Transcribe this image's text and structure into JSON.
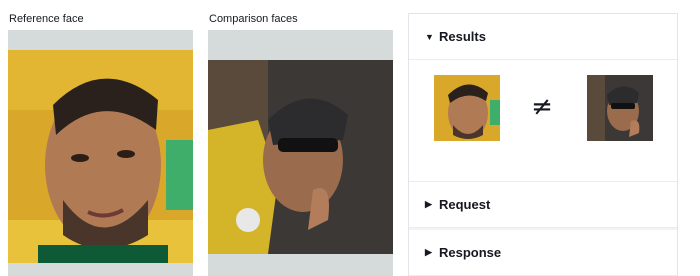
{
  "columns": {
    "reference_label": "Reference face",
    "comparison_label": "Comparison faces"
  },
  "panel": {
    "sections": [
      {
        "label": "Results",
        "state": "expanded",
        "caret": "▼"
      },
      {
        "label": "Request",
        "state": "collapsed",
        "caret": "▶"
      },
      {
        "label": "Response",
        "state": "collapsed",
        "caret": "▶"
      }
    ],
    "comparison_symbol": "≠"
  },
  "colors": {
    "image_frame_bg": "#d5dbdb",
    "panel_border": "#e1e4e8",
    "text": "#16191f"
  }
}
